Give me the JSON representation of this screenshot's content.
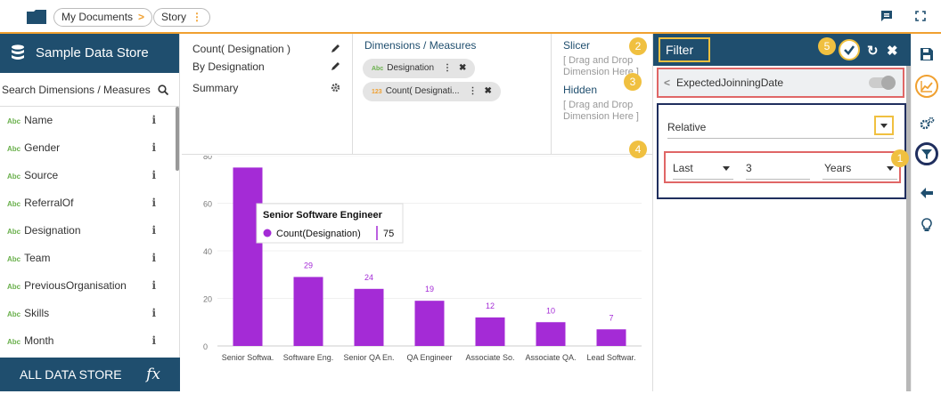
{
  "breadcrumb": {
    "root": "My Documents",
    "current": "Story"
  },
  "left_panel": {
    "title": "Sample Data Store",
    "search_placeholder": "Search Dimensions / Measures",
    "fields": [
      {
        "type": "Abc",
        "name": "Name"
      },
      {
        "type": "Abc",
        "name": "Gender"
      },
      {
        "type": "Abc",
        "name": "Source"
      },
      {
        "type": "Abc",
        "name": "ReferralOf"
      },
      {
        "type": "Abc",
        "name": "Designation"
      },
      {
        "type": "Abc",
        "name": "Team"
      },
      {
        "type": "Abc",
        "name": "PreviousOrganisation"
      },
      {
        "type": "Abc",
        "name": "Skills"
      },
      {
        "type": "Abc",
        "name": "Month"
      }
    ],
    "all_store": "ALL DATA STORE",
    "fx": "fx"
  },
  "config": {
    "measure": "Count( Designation )",
    "by": "By Designation",
    "summary": "Summary",
    "dims_title": "Dimensions / Measures",
    "chip1_type": "Abc",
    "chip1": "Designation",
    "chip2_type": "123",
    "chip2": "Count( Designati...",
    "slicer_title": "Slicer",
    "slicer_hint": "[ Drag and Drop Dimension Here ]",
    "hidden_title": "Hidden",
    "hidden_hint": "[ Drag and Drop Dimension Here ]"
  },
  "chart_data": {
    "type": "bar",
    "categories": [
      "Senior Softwa.",
      "Software Eng.",
      "Senior QA En.",
      "QA Engineer",
      "Associate So.",
      "Associate QA.",
      "Lead Softwar."
    ],
    "values": [
      75,
      29,
      24,
      19,
      12,
      10,
      7
    ],
    "data_labels": [
      "",
      "29",
      "24",
      "19",
      "12",
      "10",
      "7"
    ],
    "yticks": [
      0,
      20,
      40,
      60,
      80
    ],
    "ylim": [
      0,
      80
    ],
    "bar_color": "#a42bd6",
    "tooltip": {
      "title": "Senior Software Engineer",
      "series": "Count(Designation)",
      "value": "75"
    }
  },
  "filter": {
    "title": "Filter",
    "field": "ExpectedJoinningDate",
    "mode": "Relative",
    "period": "Last",
    "count": "3",
    "unit": "Years"
  },
  "badges": [
    "1",
    "2",
    "3",
    "4",
    "5"
  ],
  "colors": {
    "navy": "#1f4e6e",
    "accent": "#f0c040",
    "highlight": "#e06666",
    "bar": "#a42bd6"
  }
}
